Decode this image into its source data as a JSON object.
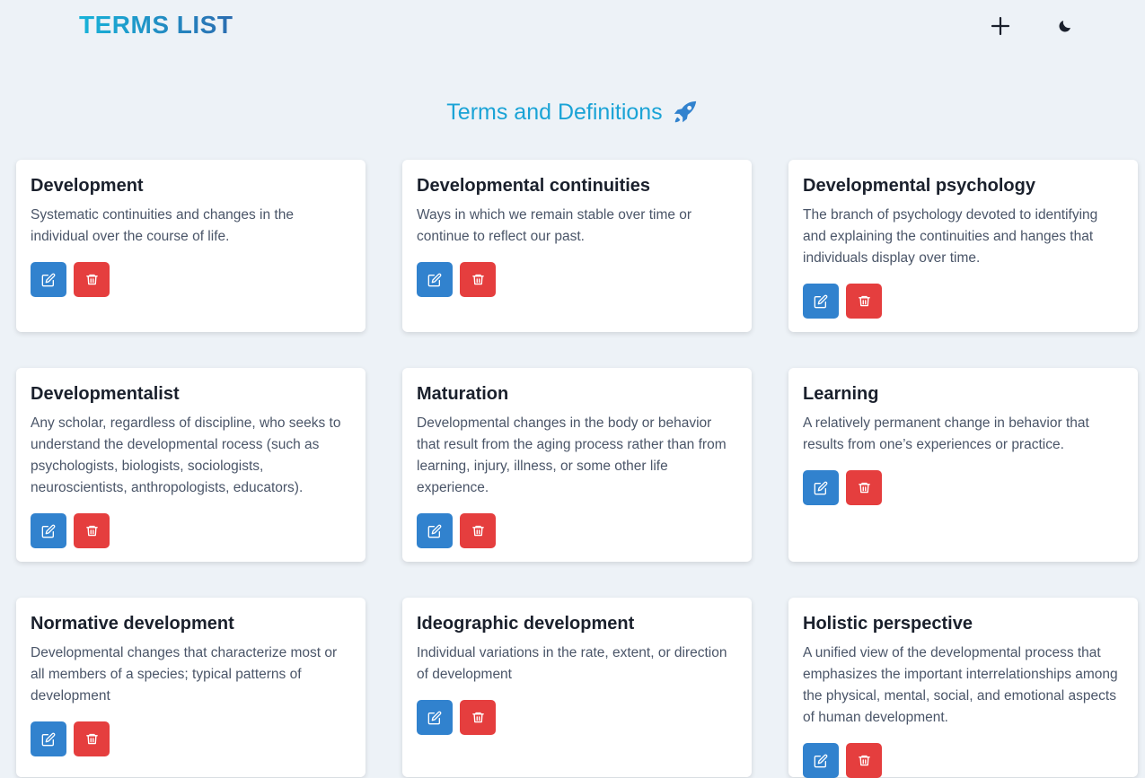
{
  "header": {
    "brand": "TERMS LIST",
    "add_icon": "plus-icon",
    "theme_icon": "moon-icon"
  },
  "page": {
    "title": "Terms and Definitions",
    "title_icon": "rocket-icon"
  },
  "colors": {
    "accent": "#1aa3d6",
    "edit": "#3182ce",
    "delete": "#e53e3e",
    "background": "#edf2f7"
  },
  "terms": [
    {
      "term": "Development",
      "definition": "Systematic continuities and changes in the individual over the course of life."
    },
    {
      "term": "Developmental continuities",
      "definition": "Ways in which we remain stable over time or continue to reflect our past."
    },
    {
      "term": "Developmental psychology",
      "definition": "The branch of psychology devoted to identifying and explaining the continuities and hanges that individuals display over time."
    },
    {
      "term": "Developmentalist",
      "definition": "Any scholar, regardless of discipline, who seeks to understand the developmental rocess (such as psychologists, biologists, sociologists, neuroscientists, anthropologists, educators)."
    },
    {
      "term": "Maturation",
      "definition": "Developmental changes in the body or behavior that result from the aging process rather than from learning, injury, illness, or some other life experience."
    },
    {
      "term": "Learning",
      "definition": "A relatively permanent change in behavior that results from one’s experiences or practice."
    },
    {
      "term": "Normative development",
      "definition": "Developmental changes that characterize most or all members of a species; typical patterns of development"
    },
    {
      "term": "Ideographic development",
      "definition": "Individual variations in the rate, extent, or direction of development"
    },
    {
      "term": "Holistic perspective",
      "definition": "A unified view of the developmental process that emphasizes the important interrelationships among the physical, mental, social, and emotional aspects of human development."
    }
  ]
}
